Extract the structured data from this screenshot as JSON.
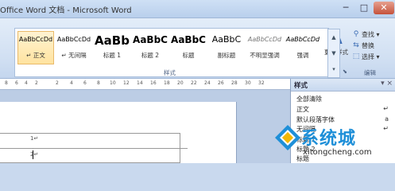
{
  "window": {
    "title": "Office Word 文档 - Microsoft Word",
    "min": "─",
    "max": "□",
    "close": "✕"
  },
  "ribbon": {
    "styles_group_label": "样式",
    "styles": [
      {
        "preview": "AaBbCcDd",
        "name": "↵ 正文",
        "selected": true
      },
      {
        "preview": "AaBbCcDd",
        "name": "↵ 无间隔",
        "selected": false
      },
      {
        "preview": "AaBb",
        "name": "标题 1",
        "selected": false
      },
      {
        "preview": "AaBbC",
        "name": "标题 2",
        "selected": false
      },
      {
        "preview": "AaBbC",
        "name": "标题",
        "selected": false
      },
      {
        "preview": "AaBbC",
        "name": "副标题",
        "selected": false
      },
      {
        "preview": "AaBbCcDd",
        "name": "不明显强调",
        "selected": false
      },
      {
        "preview": "AaBbCcDd",
        "name": "强调",
        "selected": false
      }
    ],
    "change_styles_label": "更改样式",
    "editing_group_label": "编辑",
    "editing": [
      {
        "icon": "find-icon",
        "label": "查找 ▾"
      },
      {
        "icon": "replace-icon",
        "label": "替换"
      },
      {
        "icon": "select-icon",
        "label": "选择 ▾"
      }
    ]
  },
  "ruler": {
    "ticks": [
      "8",
      "6",
      "4",
      "2",
      "2",
      "4",
      "6",
      "8",
      "10",
      "12",
      "14",
      "16",
      "18",
      "20",
      "22",
      "24",
      "26",
      "28",
      "30",
      "32"
    ]
  },
  "document": {
    "cell_marks": [
      "1↵",
      "2↵"
    ]
  },
  "styles_pane": {
    "title": "样式",
    "close": "▾ ×",
    "items": [
      {
        "label": "全部清除",
        "glyph": ""
      },
      {
        "label": "正文",
        "glyph": "↵"
      },
      {
        "label": "默认段落字体",
        "glyph": "a"
      },
      {
        "label": "无间隔",
        "glyph": "↵"
      },
      {
        "label": "标题 1",
        "glyph": ""
      },
      {
        "label": "标题 2",
        "glyph": ""
      },
      {
        "label": "标题",
        "glyph": ""
      }
    ]
  },
  "watermark": {
    "brand": "系统城",
    "url": "xitongcheng.com"
  },
  "colors": {
    "accent": "#3d6db5",
    "watermark_blue": "#1e8fd8",
    "selection": "#ffe3a0"
  }
}
